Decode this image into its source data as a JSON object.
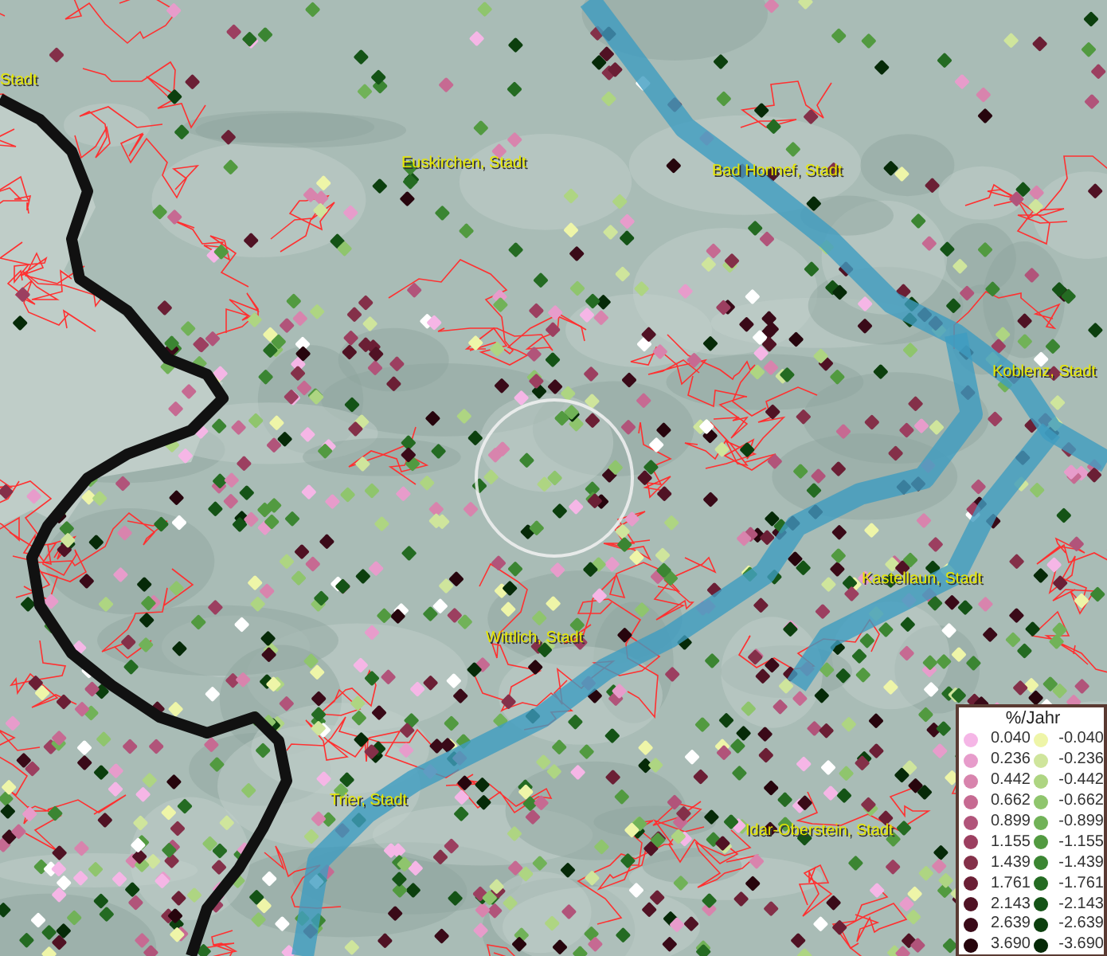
{
  "map": {
    "labels": [
      {
        "text": "Stadt"
      },
      {
        "text": "Euskirchen, Stadt"
      },
      {
        "text": "Bad Honnef, Stadt"
      },
      {
        "text": "Koblenz, Stadt"
      },
      {
        "text": "Kastellaun, Stadt"
      },
      {
        "text": "Wittlich, Stadt"
      },
      {
        "text": "Trier, Stadt"
      },
      {
        "text": "Idar-Oberstein, Stadt"
      }
    ]
  },
  "legend": {
    "title": "%/Jahr",
    "rows": [
      {
        "positive": {
          "value": "0.040",
          "color": "#f5b6e6"
        },
        "negative": {
          "value": "-0.040",
          "color": "#eef5a8"
        }
      },
      {
        "positive": {
          "value": "0.236",
          "color": "#e79ccb"
        },
        "negative": {
          "value": "-0.236",
          "color": "#cfe59c"
        }
      },
      {
        "positive": {
          "value": "0.442",
          "color": "#d884ad"
        },
        "negative": {
          "value": "-0.442",
          "color": "#aed582"
        }
      },
      {
        "positive": {
          "value": "0.662",
          "color": "#c66a92"
        },
        "negative": {
          "value": "-0.662",
          "color": "#8fc56d"
        }
      },
      {
        "positive": {
          "value": "0.899",
          "color": "#b1547a"
        },
        "negative": {
          "value": "-0.899",
          "color": "#71b258"
        }
      },
      {
        "positive": {
          "value": "1.155",
          "color": "#9c3f60"
        },
        "negative": {
          "value": "-1.155",
          "color": "#529a40"
        }
      },
      {
        "positive": {
          "value": "1.439",
          "color": "#843049"
        },
        "negative": {
          "value": "-1.439",
          "color": "#3b8532"
        }
      },
      {
        "positive": {
          "value": "1.761",
          "color": "#6b1f35"
        },
        "negative": {
          "value": "-1.761",
          "color": "#246b22"
        }
      },
      {
        "positive": {
          "value": "2.143",
          "color": "#501224"
        },
        "negative": {
          "value": "-2.143",
          "color": "#145316"
        }
      },
      {
        "positive": {
          "value": "2.639",
          "color": "#3a0a18"
        },
        "negative": {
          "value": "-2.639",
          "color": "#0c3f0e"
        }
      },
      {
        "positive": {
          "value": "3.690",
          "color": "#27050d"
        },
        "negative": {
          "value": "-3.690",
          "color": "#062a08"
        }
      }
    ]
  }
}
